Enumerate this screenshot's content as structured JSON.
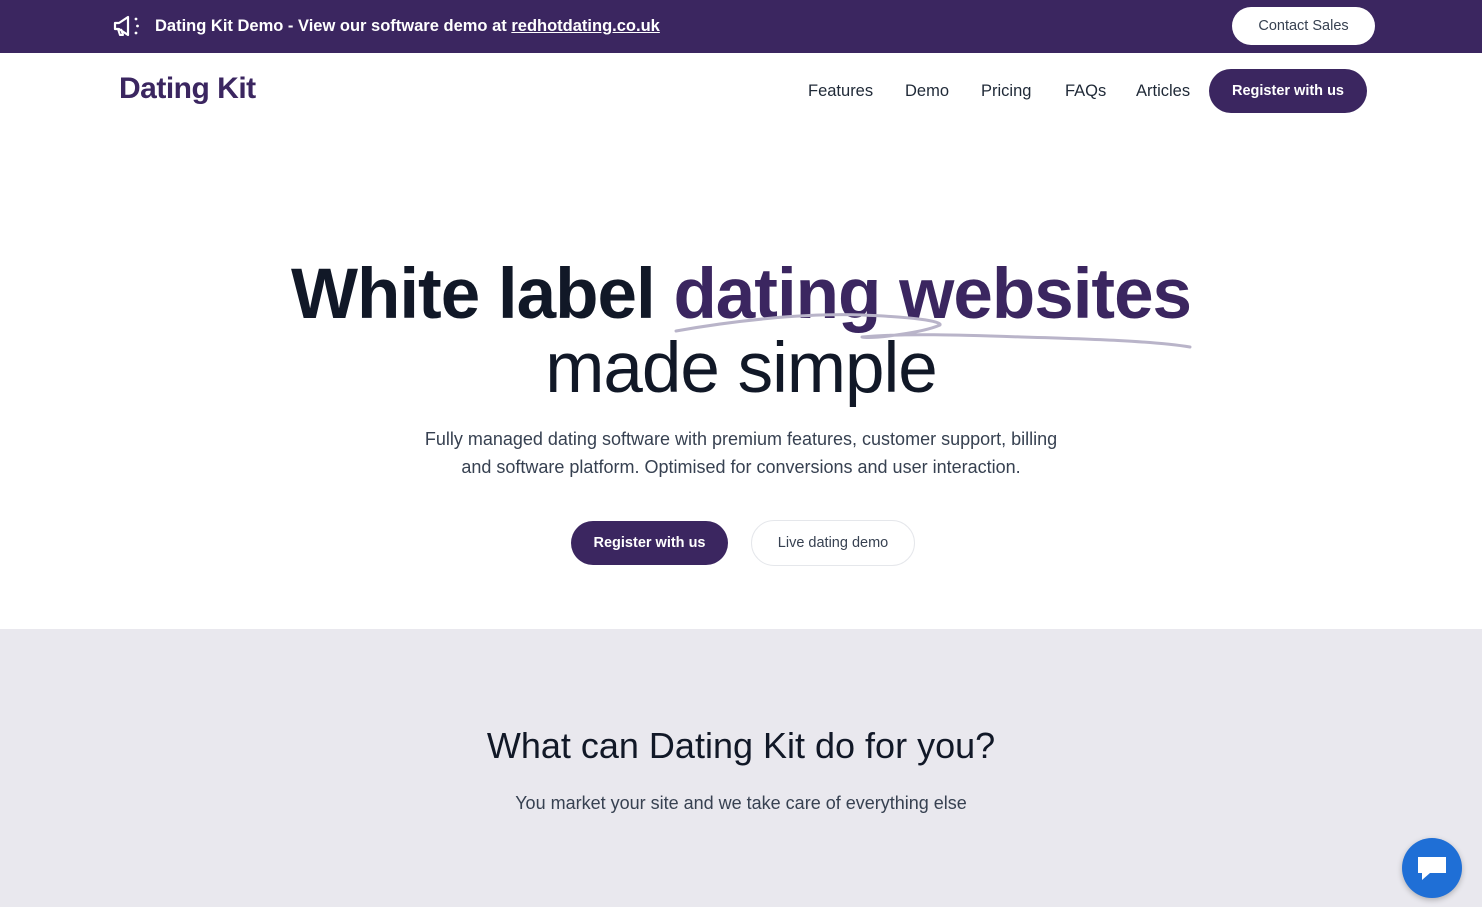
{
  "announcement": {
    "text": "Dating Kit Demo - View our software demo at ",
    "link_text": "redhotdating.co.uk",
    "contact_label": "Contact Sales"
  },
  "header": {
    "logo": "Dating Kit",
    "nav": [
      "Features",
      "Demo",
      "Pricing",
      "FAQs",
      "Articles"
    ],
    "register_label": "Register with us"
  },
  "hero": {
    "title_part1": "White label ",
    "title_accent": "dating websites",
    "title_line2": "made simple",
    "subtitle_line1": "Fully managed dating software with premium features, customer support, billing",
    "subtitle_line2": "and software platform. Optimised for conversions and user interaction.",
    "primary_cta": "Register with us",
    "secondary_cta": "Live dating demo"
  },
  "features": {
    "heading": "What can Dating Kit do for you?",
    "subheading": "You market your site and we take care of everything else"
  },
  "colors": {
    "brand": "#3b2660",
    "section_bg": "#e9e8ee",
    "chat": "#1f6fd6"
  },
  "icons": {
    "announcement": "megaphone-icon",
    "chat": "chat-bubble-icon"
  }
}
